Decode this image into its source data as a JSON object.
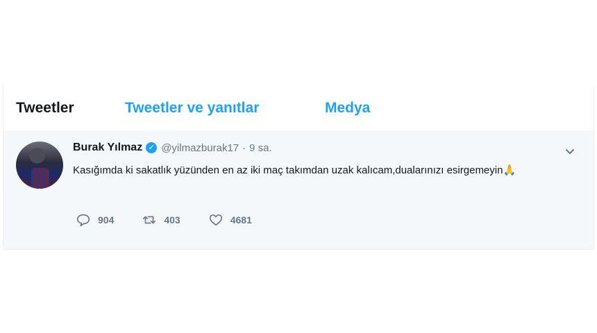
{
  "tabs": [
    {
      "label": "Tweetler"
    },
    {
      "label": "Tweetler ve yanıtlar"
    },
    {
      "label": "Medya"
    }
  ],
  "tweet": {
    "author_name": "Burak Yılmaz",
    "verified_icon": "verified-badge-icon",
    "handle": "@yilmazburak17",
    "separator": "·",
    "time": "9 sa.",
    "text": "Kasığımda ki sakatlık yüzünden en az iki maç takımdan uzak kalıcam,dualarınızı esirgemeyin",
    "emoji": "🙏",
    "replies": "904",
    "retweets": "403",
    "likes": "4681"
  },
  "colors": {
    "accent": "#1da1f2",
    "text": "#14171a",
    "muted": "#657786",
    "tweet_bg": "#f5f8fa"
  }
}
